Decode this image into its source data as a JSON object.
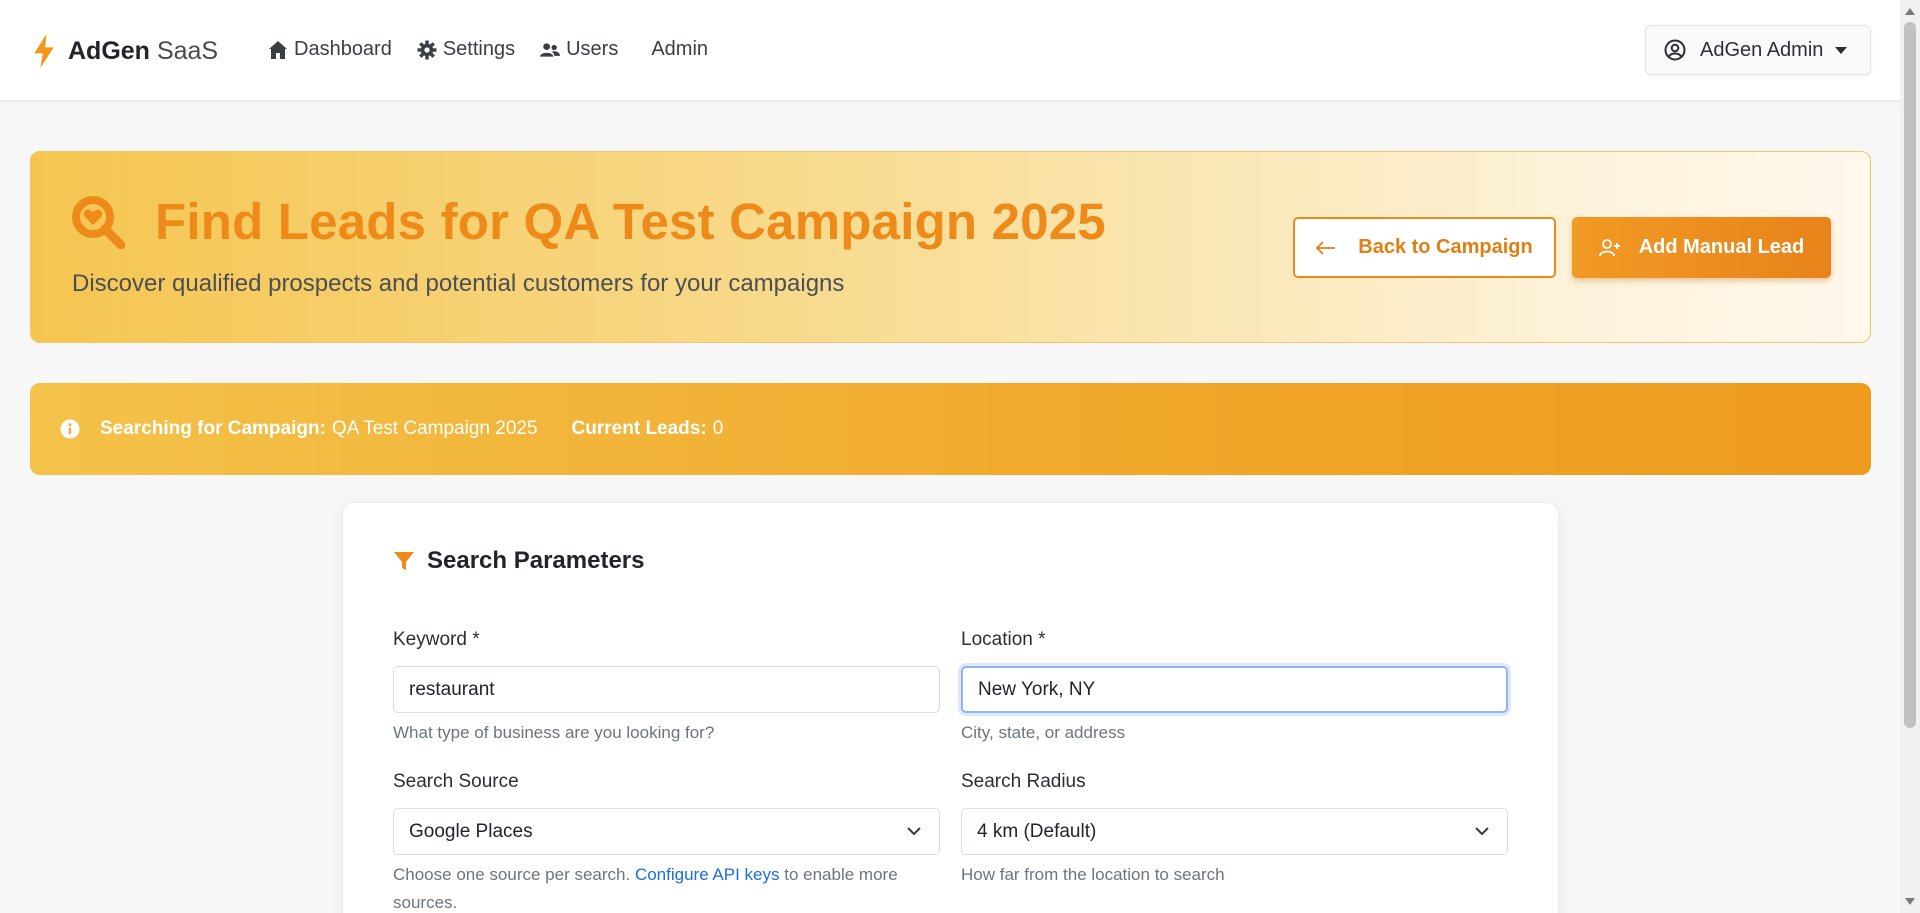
{
  "navbar": {
    "brand_bold": "AdGen",
    "brand_light": "SaaS",
    "brand_icon": "bolt-icon",
    "links": [
      {
        "label": "Dashboard",
        "icon": "home-icon"
      },
      {
        "label": "Settings",
        "icon": "gear-icon"
      },
      {
        "label": "Users",
        "icon": "users-icon"
      },
      {
        "label": "Admin",
        "icon": ""
      }
    ],
    "user_menu": {
      "label": "AdGen Admin",
      "icon": "user-circle-icon"
    }
  },
  "hero": {
    "title": "Find Leads for QA Test Campaign 2025",
    "subtitle": "Discover qualified prospects and potential customers for your campaigns",
    "back_button": "Back to Campaign",
    "add_button": "Add Manual Lead"
  },
  "info_banner": {
    "campaign_label": "Searching for Campaign:",
    "campaign_value": "QA Test Campaign 2025",
    "leads_label": "Current Leads:",
    "leads_value": "0"
  },
  "search_card": {
    "title": "Search Parameters",
    "keyword": {
      "label": "Keyword *",
      "value": "restaurant",
      "help": "What type of business are you looking for?"
    },
    "location": {
      "label": "Location *",
      "value": "New York, NY",
      "help": "City, state, or address"
    },
    "source": {
      "label": "Search Source",
      "value": "Google Places",
      "help_prefix": "Choose one source per search.",
      "help_link": "Configure API keys",
      "help_suffix": "to enable more sources."
    },
    "radius": {
      "label": "Search Radius",
      "value": "4 km (Default)",
      "help": "How far from the location to search"
    }
  },
  "colors": {
    "accent": "#ee8a19",
    "banner_start": "#f4c24a",
    "banner_end": "#ee9b1f",
    "link": "#1a6fd9",
    "focus_border": "#8fb6ee"
  }
}
